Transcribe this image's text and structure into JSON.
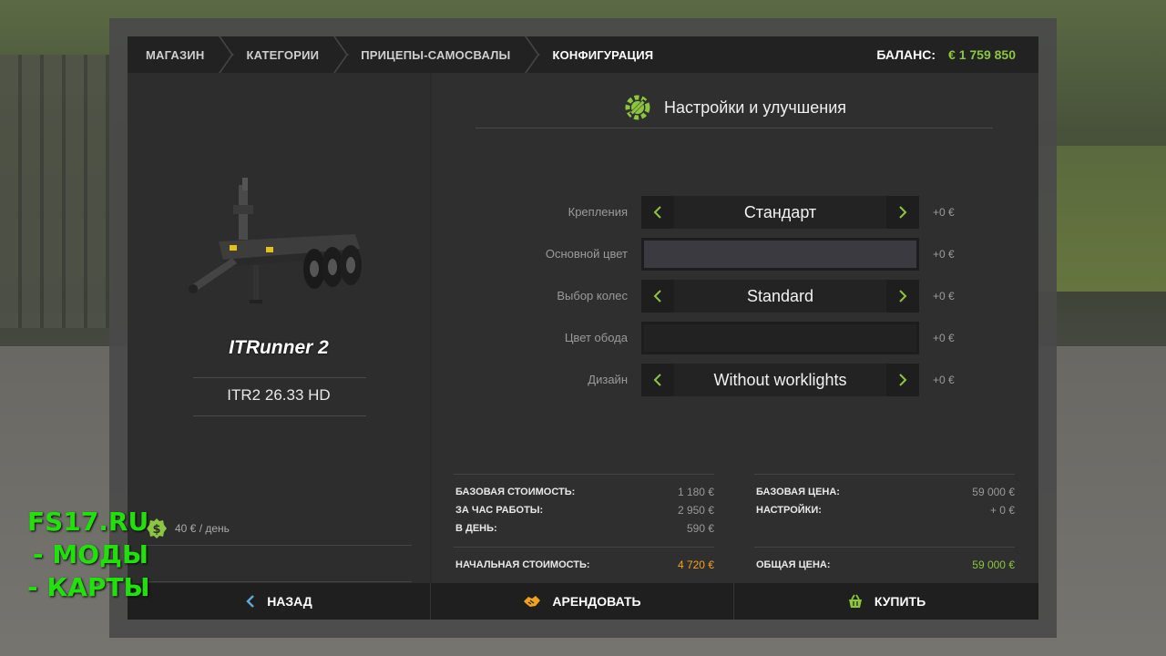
{
  "breadcrumb": {
    "items": [
      "МАГАЗИН",
      "КАТЕГОРИИ",
      "ПРИЦЕПЫ-САМОСВАЛЫ",
      "КОНФИГУРАЦИЯ"
    ]
  },
  "balance": {
    "label": "БАЛАНС:",
    "value": "€ 1 759 850"
  },
  "vehicle": {
    "name": "ITRunner 2",
    "model": "ITR2 26.33 HD",
    "rent_per_day": "40 € / день"
  },
  "config": {
    "title": "Настройки и улучшения",
    "options": [
      {
        "label": "Крепления",
        "type": "selector",
        "value": "Стандарт",
        "price": "+0 €"
      },
      {
        "label": "Основной цвет",
        "type": "color",
        "color": "#3a3a40",
        "price": "+0 €"
      },
      {
        "label": "Выбор колес",
        "type": "selector",
        "value": "Standard",
        "price": "+0 €"
      },
      {
        "label": "Цвет обода",
        "type": "color",
        "color": "#222222",
        "price": "+0 €"
      },
      {
        "label": "Дизайн",
        "type": "selector",
        "value": "Without worklights",
        "price": "+0 €"
      }
    ]
  },
  "costs": {
    "left": [
      {
        "label": "БАЗОВАЯ СТОИМОСТЬ:",
        "value": "1 180 €"
      },
      {
        "label": "ЗА ЧАС РАБОТЫ:",
        "value": "2 950 €"
      },
      {
        "label": "В ДЕНЬ:",
        "value": "590 €"
      }
    ],
    "left_total": {
      "label": "НАЧАЛЬНАЯ СТОИМОСТЬ:",
      "value": "4 720 €"
    },
    "right": [
      {
        "label": "БАЗОВАЯ ЦЕНА:",
        "value": "59 000 €"
      },
      {
        "label": "НАСТРОЙКИ:",
        "value": "+ 0 €"
      }
    ],
    "right_total": {
      "label": "ОБЩАЯ ЦЕНА:",
      "value": "59 000 €"
    }
  },
  "actions": {
    "back": "НАЗАД",
    "lease": "АРЕНДОВАТЬ",
    "buy": "КУПИТЬ"
  },
  "watermark": [
    "FS17.RU",
    "- МОДЫ",
    "- КАРТЫ"
  ],
  "colors": {
    "accent_green": "#8cc63f",
    "accent_orange": "#f4a21a",
    "watermark_green": "#22e00a"
  }
}
